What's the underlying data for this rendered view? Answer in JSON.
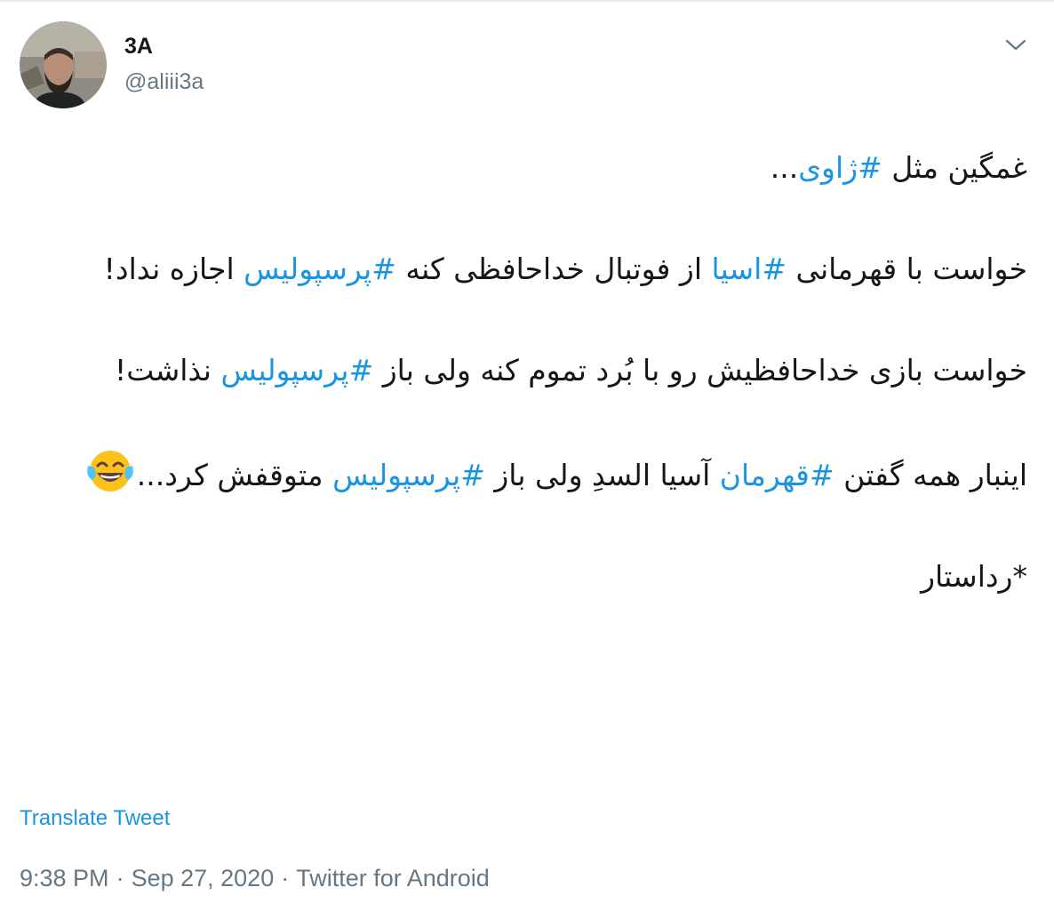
{
  "author": {
    "display_name": "3A",
    "handle": "@aliii3a"
  },
  "tweet": {
    "lines": [
      {
        "text_before": "غمگین مثل ",
        "hashtag": "#ژاوی",
        "text_after": "..."
      },
      {
        "text_before": "خواست با قهرمانی ",
        "hashtag": "#اسیا",
        "text_middle": " از فوتبال خداحافظی کنه ",
        "hashtag2": "#پرسپولیس",
        "text_after": " اجازه نداد!"
      },
      {
        "text_before": "خواست بازی خداحافظیش رو با بُرد تموم کنه ولی باز ",
        "hashtag": "#پرسپولیس",
        "text_after": " نذاشت!"
      },
      {
        "text_before": "اینبار همه گفتن ",
        "hashtag": "#قهرمان",
        "text_middle": " آسیا السدِ ولی باز ",
        "hashtag2": "#پرسپولیس",
        "text_after": " متوقفش کرد..."
      },
      {
        "text": "*رداستار"
      }
    ],
    "emoji": "face-with-tears-of-joy"
  },
  "translate_label": "Translate Tweet",
  "meta": {
    "time": "9:38 PM",
    "separator": "·",
    "date": "Sep 27, 2020",
    "source": "Twitter for Android"
  },
  "colors": {
    "link": "#1b95e0",
    "text": "#14171a",
    "secondary": "#657786"
  },
  "icons": {
    "menu": "chevron-down-icon"
  }
}
